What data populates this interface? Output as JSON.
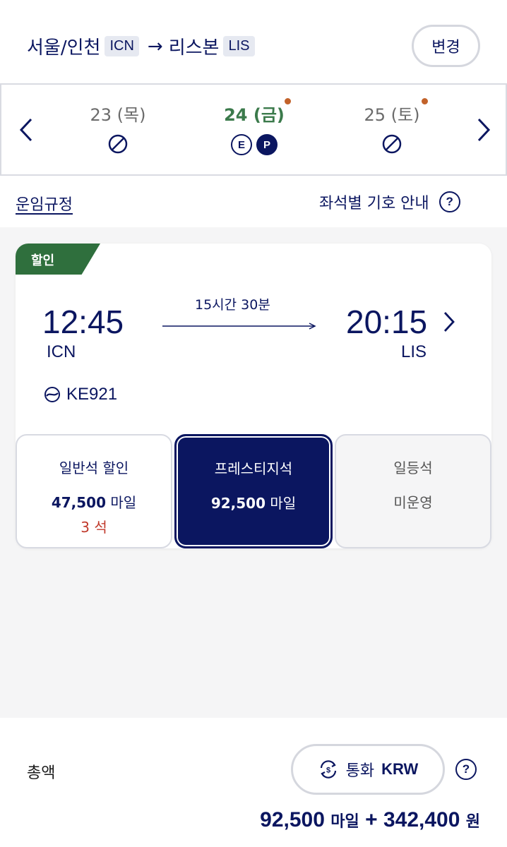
{
  "header": {
    "origin_city": "서울/인천",
    "origin_code": "ICN",
    "arrow": "→",
    "dest_city": "리스본",
    "dest_code": "LIS",
    "change_label": "변경"
  },
  "dates": [
    {
      "label": "23 (목)",
      "available": false,
      "selected": false,
      "has_dot": false
    },
    {
      "label": "24 (금)",
      "available": true,
      "selected": true,
      "has_dot": true,
      "classes": [
        "E",
        "P"
      ]
    },
    {
      "label": "25 (토)",
      "available": false,
      "selected": false,
      "has_dot": true
    }
  ],
  "links": {
    "fare_rules": "운임규정",
    "seat_guide": "좌석별 기호 안내",
    "help": "?"
  },
  "flight": {
    "tag": "할인",
    "dep_time": "12:45",
    "dep_code": "ICN",
    "duration": "15시간 30분",
    "arr_time": "20:15",
    "arr_code": "LIS",
    "flight_no": "KE921",
    "fares": {
      "economy": {
        "name": "일반석 할인",
        "miles": "47,500",
        "unit": "마일",
        "seats": "3 석"
      },
      "prestige": {
        "name": "프레스티지석",
        "miles": "92,500",
        "unit": "마일"
      },
      "first": {
        "name": "일등석",
        "status": "미운영"
      }
    }
  },
  "footer": {
    "total_label": "총액",
    "currency_prefix": "통화",
    "currency": "KRW",
    "help": "?",
    "total_miles": "92,500",
    "miles_unit": "마일",
    "plus": "+",
    "total_won": "342,400",
    "won_unit": "원"
  },
  "colors": {
    "navy": "#0b1660",
    "green": "#2f6f3d",
    "selected_date": "#3b7a4b",
    "dot": "#c2622a",
    "seats_red": "#c0392b"
  }
}
